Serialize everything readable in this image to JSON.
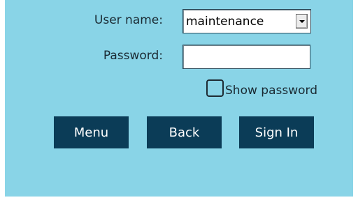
{
  "form": {
    "username_label": "User name:",
    "username_value": "maintenance",
    "password_label": "Password:",
    "password_value": "",
    "show_password_label": "Show password",
    "show_password_checked": false
  },
  "buttons": {
    "menu": "Menu",
    "back": "Back",
    "sign_in": "Sign In"
  },
  "colors": {
    "background": "#89d4e7",
    "button": "#0b3c57",
    "button_text": "#ffffff"
  },
  "icons": {
    "dropdown": "chevron-down-icon",
    "checkbox": "checkbox-unchecked-icon"
  }
}
